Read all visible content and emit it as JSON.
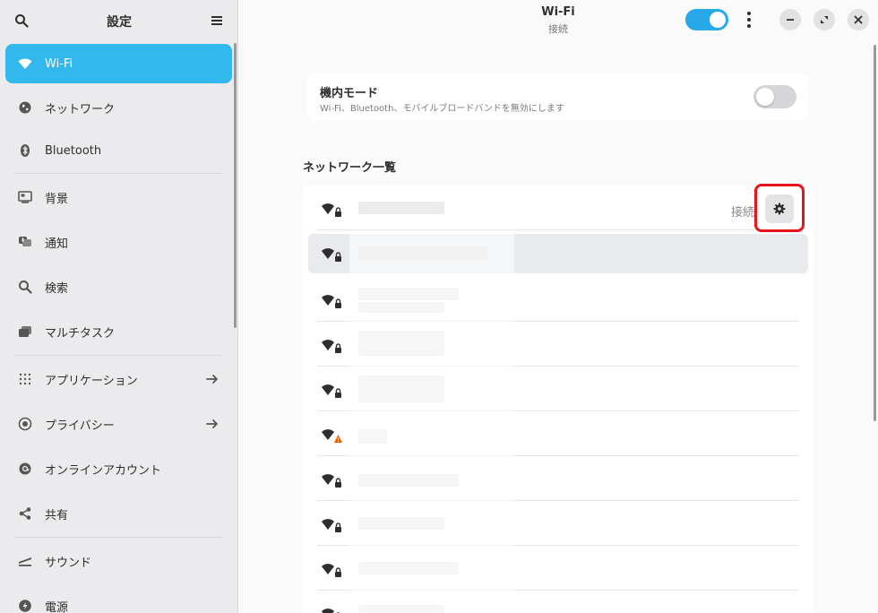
{
  "sidebar": {
    "title": "設定",
    "items": [
      {
        "label": "Wi-Fi",
        "icon": "wifi-icon"
      },
      {
        "label": "ネットワーク",
        "icon": "globe-icon"
      },
      {
        "label": "Bluetooth",
        "icon": "bluetooth-icon"
      },
      {
        "label": "背景",
        "icon": "display-icon"
      },
      {
        "label": "通知",
        "icon": "bell-icon"
      },
      {
        "label": "検索",
        "icon": "search-icon"
      },
      {
        "label": "マルチタスク",
        "icon": "multitasking-icon"
      },
      {
        "label": "アプリケーション",
        "icon": "apps-grid-icon"
      },
      {
        "label": "プライバシー",
        "icon": "privacy-icon"
      },
      {
        "label": "オンラインアカウント",
        "icon": "at-icon"
      },
      {
        "label": "共有",
        "icon": "share-icon"
      },
      {
        "label": "サウンド",
        "icon": "speaker-icon"
      },
      {
        "label": "電源",
        "icon": "power-icon"
      }
    ]
  },
  "header": {
    "title": "Wi-Fi",
    "subtitle": "接続",
    "wifi_enabled": true
  },
  "airplane": {
    "title": "機内モード",
    "desc": "Wi-Fi、Bluetooth、モバイルブロードバンドを無効にします",
    "enabled": false
  },
  "networks": {
    "title": "ネットワーク一覧",
    "connected_status": "接続",
    "rows": [
      {
        "secured": true,
        "connected": true
      },
      {
        "secured": true,
        "selected": true
      },
      {
        "secured": true
      },
      {
        "secured": true
      },
      {
        "secured": true
      },
      {
        "secured": false,
        "warning": true
      },
      {
        "secured": true
      },
      {
        "secured": true
      },
      {
        "secured": true
      },
      {
        "secured": true
      }
    ]
  },
  "colors": {
    "accent": "#33b8ee",
    "highlight": "#e8131a",
    "warning": "#e66100"
  }
}
